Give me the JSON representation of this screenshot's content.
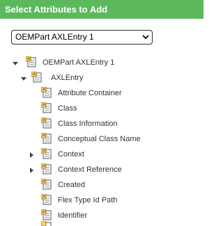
{
  "header": {
    "title": "Select Attributes to Add"
  },
  "selector": {
    "value": "OEMPart AXLEntry 1"
  },
  "tree": {
    "root_label": "OEMPart AXLEntry 1",
    "entry_label": "AXLEntry",
    "items": [
      {
        "label": "Attribute Container",
        "expandable": false
      },
      {
        "label": "Class",
        "expandable": false
      },
      {
        "label": "Class Information",
        "expandable": false
      },
      {
        "label": "Conceptual Class Name",
        "expandable": false
      },
      {
        "label": "Context",
        "expandable": true
      },
      {
        "label": "Context Reference",
        "expandable": true
      },
      {
        "label": "Created",
        "expandable": false
      },
      {
        "label": "Flex Type Id Path",
        "expandable": false
      },
      {
        "label": "Identifier",
        "expandable": false
      }
    ]
  }
}
